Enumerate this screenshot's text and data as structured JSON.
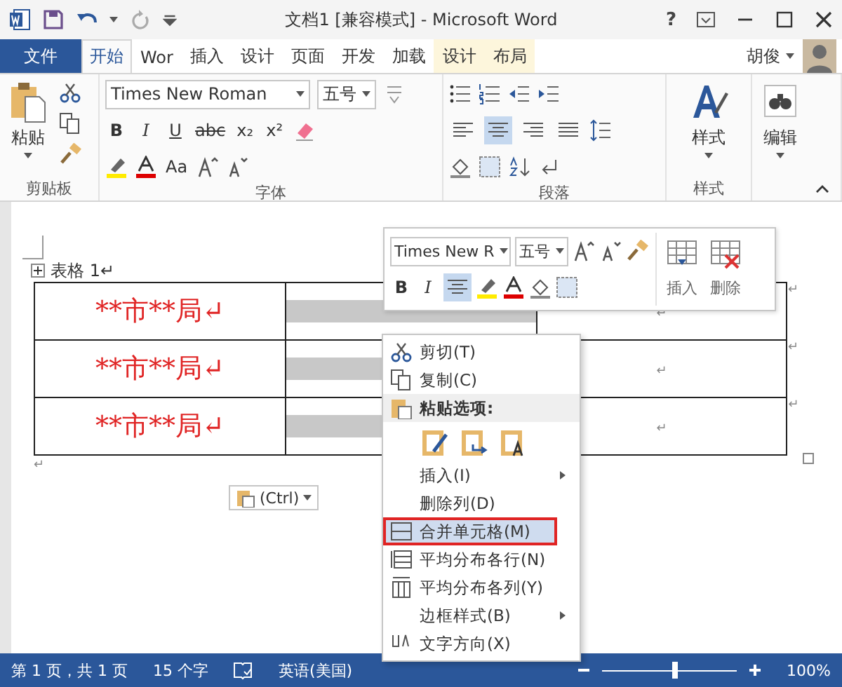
{
  "window": {
    "title": "文档1 [兼容模式] - Microsoft Word",
    "help": "?"
  },
  "tabs": [
    {
      "label": "文件",
      "kind": "file",
      "selected": false
    },
    {
      "label": "开始",
      "kind": "tab",
      "selected": true
    },
    {
      "label": "Wor",
      "kind": "tab",
      "selected": false
    },
    {
      "label": "插入",
      "kind": "tab",
      "selected": false
    },
    {
      "label": "设计",
      "kind": "tab",
      "selected": false
    },
    {
      "label": "页面",
      "kind": "tab",
      "selected": false
    },
    {
      "label": "开发",
      "kind": "tab",
      "selected": false
    },
    {
      "label": "加载",
      "kind": "tab",
      "selected": false
    },
    {
      "label": "设计",
      "kind": "context",
      "selected": false
    },
    {
      "label": "布局",
      "kind": "context",
      "selected": false
    }
  ],
  "user": {
    "name": "胡俊"
  },
  "ribbon": {
    "clipboard": {
      "label": "剪贴板",
      "paste": "粘贴"
    },
    "font": {
      "label": "字体",
      "name": "Times New Roman",
      "size": "五号",
      "format_buttons": [
        "B",
        "I",
        "U",
        "abc",
        "x₂",
        "x²"
      ],
      "case_button": "Aa"
    },
    "paragraph": {
      "label": "段落",
      "align_buttons": [
        {
          "selected": false
        },
        {
          "selected": true
        },
        {
          "selected": false
        },
        {
          "selected": false
        }
      ]
    },
    "styles": {
      "label": "样式",
      "button": "样式"
    },
    "editing": {
      "button": "编辑"
    }
  },
  "document": {
    "caption": "表格 1↵",
    "rows": [
      [
        {
          "text": "**市**局↵",
          "selected": false
        },
        {
          "selected": true
        },
        {
          "text": "↵",
          "selected": false
        }
      ],
      [
        {
          "text": "**市**局↵",
          "selected": false
        },
        {
          "selected": true
        },
        {
          "text": "↵",
          "selected": false
        }
      ],
      [
        {
          "text": "**市**局↵",
          "selected": false
        },
        {
          "selected": true
        },
        {
          "text": "↵",
          "selected": false
        }
      ]
    ],
    "row_marks": [
      "↵",
      "↵",
      "↵"
    ],
    "after": "↵"
  },
  "mini_toolbar": {
    "font": "Times New R",
    "size": "五号",
    "bold": "B",
    "italic": "I",
    "center_selected": true,
    "insert": "插入",
    "delete": "删除"
  },
  "paste_button": {
    "label": "(Ctrl)"
  },
  "context_menu": [
    {
      "kind": "item",
      "label": "剪切(T)",
      "selected": false
    },
    {
      "kind": "item",
      "label": "复制(C)",
      "selected": false
    },
    {
      "kind": "header",
      "label": "粘贴选项:"
    },
    {
      "kind": "paste_options"
    },
    {
      "kind": "submenu",
      "label": "插入(I)",
      "selected": false
    },
    {
      "kind": "item",
      "label": "删除列(D)",
      "selected": false
    },
    {
      "kind": "item",
      "label": "合并单元格(M)",
      "selected": true
    },
    {
      "kind": "item",
      "label": "平均分布各行(N)",
      "selected": false
    },
    {
      "kind": "item",
      "label": "平均分布各列(Y)",
      "selected": false
    },
    {
      "kind": "submenu",
      "label": "边框样式(B)",
      "selected": false
    },
    {
      "kind": "item",
      "label": "文字方向(X)",
      "selected": false
    }
  ],
  "status_bar": {
    "page": "第 1 页，共 1 页",
    "words": "15 个字",
    "language": "英语(美国)",
    "zoom": {
      "level": 0.55
    },
    "zoom_text": "100%"
  }
}
